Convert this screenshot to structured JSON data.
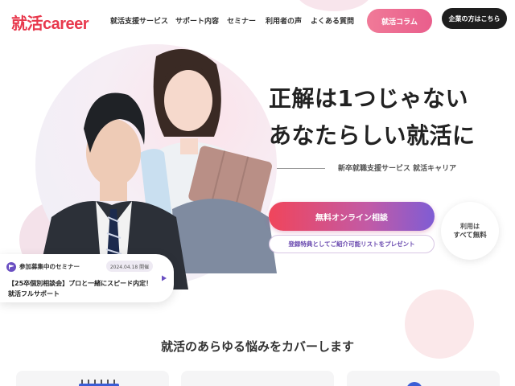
{
  "header": {
    "logo": "就活career",
    "nav": [
      "就活支援サービス",
      "サポート内容",
      "セミナー",
      "利用者の声",
      "よくある質問"
    ],
    "column_button": "就活コラム",
    "company_button": "企業の方はこちら"
  },
  "hero": {
    "headline_line1": "正解は1つじゃない",
    "headline_line2": "あなたらしい就活に",
    "subtitle": "新卒就職支援サービス 就活キャリア",
    "cta": "無料オンライン相談",
    "cta_sub": "登録特典としてご紹介可能リストをプレゼント",
    "badge_line1": "利用は",
    "badge_line2": "すべて無料"
  },
  "seminar": {
    "label": "参加募集中のセミナー",
    "date": "2024.04.18 開催",
    "title": "【25卒個別相談会】プロと一緒にスピード内定！就活フルサポート"
  },
  "section": {
    "title": "就活のあらゆる悩みをカバーします"
  },
  "colors": {
    "brand": "#e8394d",
    "column_button": "#ee6f93",
    "cta_start": "#f0455b",
    "cta_end": "#7f5cd4"
  }
}
